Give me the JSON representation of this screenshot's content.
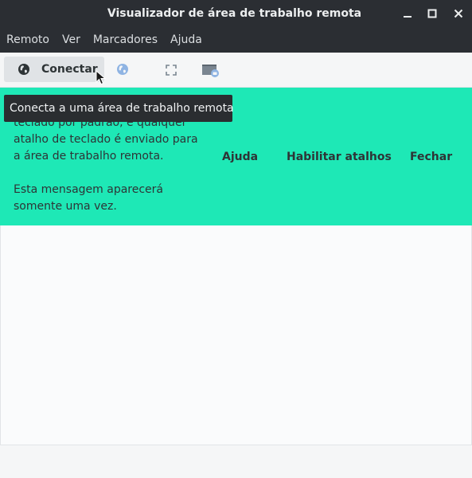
{
  "window": {
    "title": "Visualizador de área de trabalho remota",
    "controls": [
      "minimize-icon",
      "maximize-icon",
      "close-icon"
    ]
  },
  "menu": {
    "items": [
      "Remoto",
      "Ver",
      "Marcadores",
      "Ajuda"
    ]
  },
  "toolbar": {
    "connect_label": "Conectar",
    "icons": [
      "globe-icon",
      "globe-icon",
      "fullscreen-icon",
      "screenshot-icon"
    ]
  },
  "tooltip": {
    "text": "Conecta a uma área de trabalho remota"
  },
  "infobar": {
    "message": "teclado por padrão, e qualquer\natalho de teclado é enviado para\na área de trabalho remota.\n\nEsta mensagem aparecerá\nsomente uma vez.",
    "buttons": [
      "Ajuda",
      "Habilitar atalhos",
      "Fechar"
    ],
    "color": "#1ee8b6"
  },
  "colors": {
    "titlebar": "#2b2e33",
    "toolbar": "#f5f6f7",
    "content": "#fafbfc"
  }
}
